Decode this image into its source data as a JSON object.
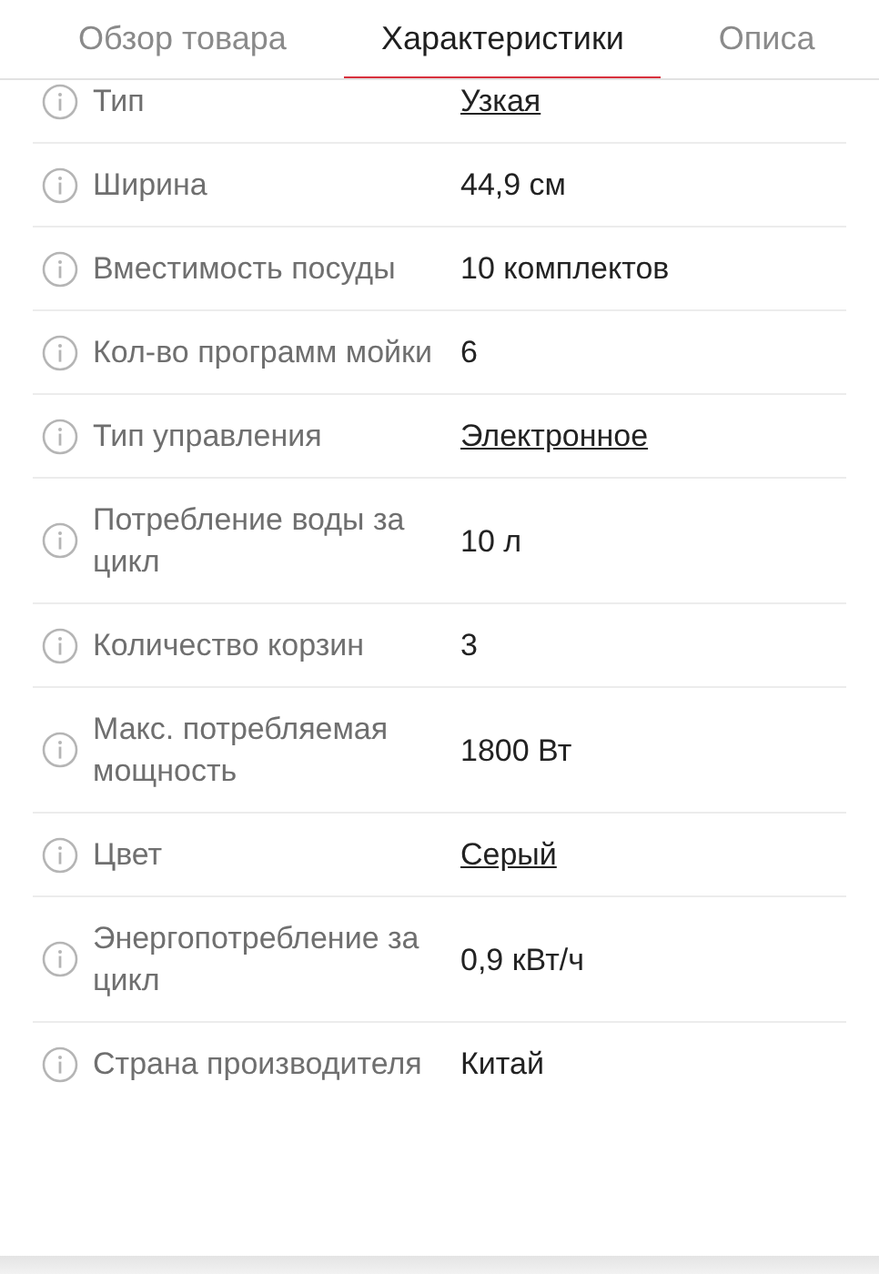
{
  "tabs": [
    {
      "label": "Обзор товара",
      "selected": false
    },
    {
      "label": "Характеристики",
      "selected": true
    },
    {
      "label": "Описа",
      "selected": false
    }
  ],
  "specs": [
    {
      "label": "Тип",
      "value": "Узкая",
      "kind": "link"
    },
    {
      "label": "Ширина",
      "value": "44,9 см",
      "kind": "text"
    },
    {
      "label": "Вместимость посуды",
      "value": "10 комплектов",
      "kind": "text"
    },
    {
      "label": "Кол-во программ мойки",
      "value": "6",
      "kind": "text"
    },
    {
      "label": "Тип управления",
      "value": "Электронное",
      "kind": "link"
    },
    {
      "label": "Потребление воды за цикл",
      "value": "10 л",
      "kind": "text"
    },
    {
      "label": "Количество корзин",
      "value": "3",
      "kind": "text"
    },
    {
      "label": "Макс. потребляемая мощность",
      "value": "1800 Вт",
      "kind": "text"
    },
    {
      "label": "Цвет",
      "value": "Серый",
      "kind": "link"
    },
    {
      "label": "Энергопотребление за цикл",
      "value": "0,9 кВт/ч",
      "kind": "text"
    },
    {
      "label": "Страна производителя",
      "value": "Китай",
      "kind": "text"
    }
  ]
}
